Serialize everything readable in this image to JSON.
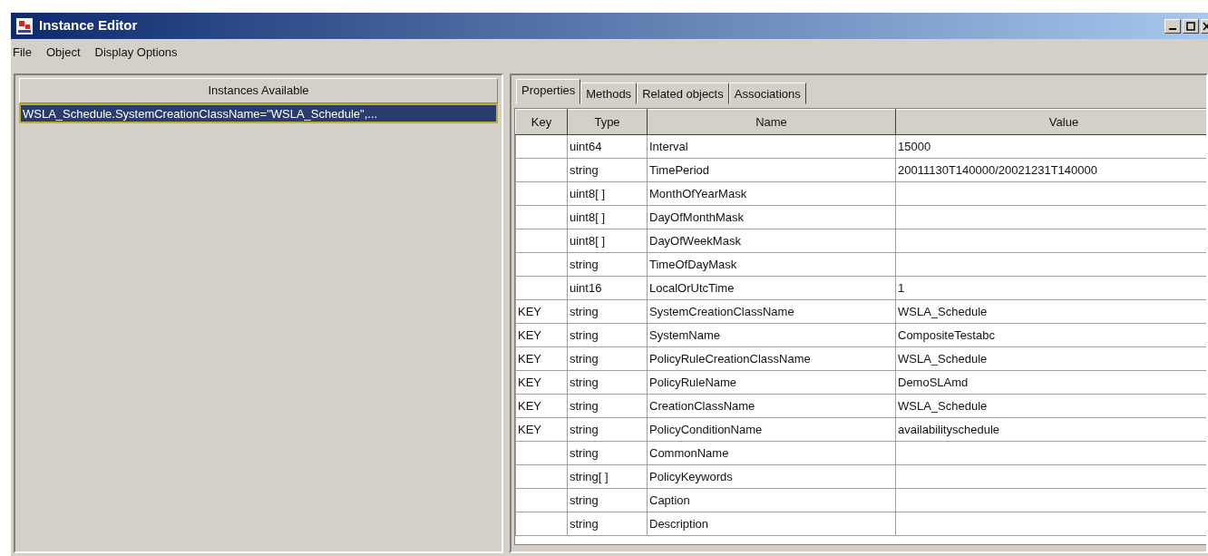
{
  "window": {
    "title": "Instance Editor"
  },
  "menu": [
    "File",
    "Object",
    "Display Options"
  ],
  "instances": {
    "header": "Instances Available",
    "items": [
      {
        "label": "WSLA_Schedule.SystemCreationClassName=\"WSLA_Schedule\",...",
        "selected": true
      }
    ]
  },
  "tabs": [
    {
      "label": "Properties",
      "selected": true
    },
    {
      "label": "Methods",
      "selected": false
    },
    {
      "label": "Related objects",
      "selected": false
    },
    {
      "label": "Associations",
      "selected": false
    }
  ],
  "table": {
    "columns": [
      "Key",
      "Type",
      "Name",
      "Value"
    ],
    "rows": [
      {
        "type": "uint64",
        "name": "Interval",
        "value": "15000"
      },
      {
        "type": "string",
        "name": "TimePeriod",
        "value": "20011130T140000/20021231T140000"
      },
      {
        "type": "uint8[ ]",
        "name": "MonthOfYearMask"
      },
      {
        "type": "uint8[ ]",
        "name": "DayOfMonthMask"
      },
      {
        "type": "uint8[ ]",
        "name": "DayOfWeekMask"
      },
      {
        "type": "string",
        "name": "TimeOfDayMask"
      },
      {
        "type": "uint16",
        "name": "LocalOrUtcTime",
        "value": "1"
      },
      {
        "key": "KEY",
        "type": "string",
        "name": "SystemCreationClassName",
        "value": "WSLA_Schedule"
      },
      {
        "key": "KEY",
        "type": "string",
        "name": "SystemName",
        "value": "CompositeTestabc"
      },
      {
        "key": "KEY",
        "type": "string",
        "name": "PolicyRuleCreationClassName",
        "value": "WSLA_Schedule"
      },
      {
        "key": "KEY",
        "type": "string",
        "name": "PolicyRuleName",
        "value": "DemoSLAmd"
      },
      {
        "key": "KEY",
        "type": "string",
        "name": "CreationClassName",
        "value": "WSLA_Schedule"
      },
      {
        "key": "KEY",
        "type": "string",
        "name": "PolicyConditionName",
        "value": "availabilityschedule"
      },
      {
        "type": "string",
        "name": "CommonName"
      },
      {
        "type": "string[ ]",
        "name": "PolicyKeywords"
      },
      {
        "type": "string",
        "name": "Caption"
      },
      {
        "type": "string",
        "name": "Description"
      }
    ]
  }
}
